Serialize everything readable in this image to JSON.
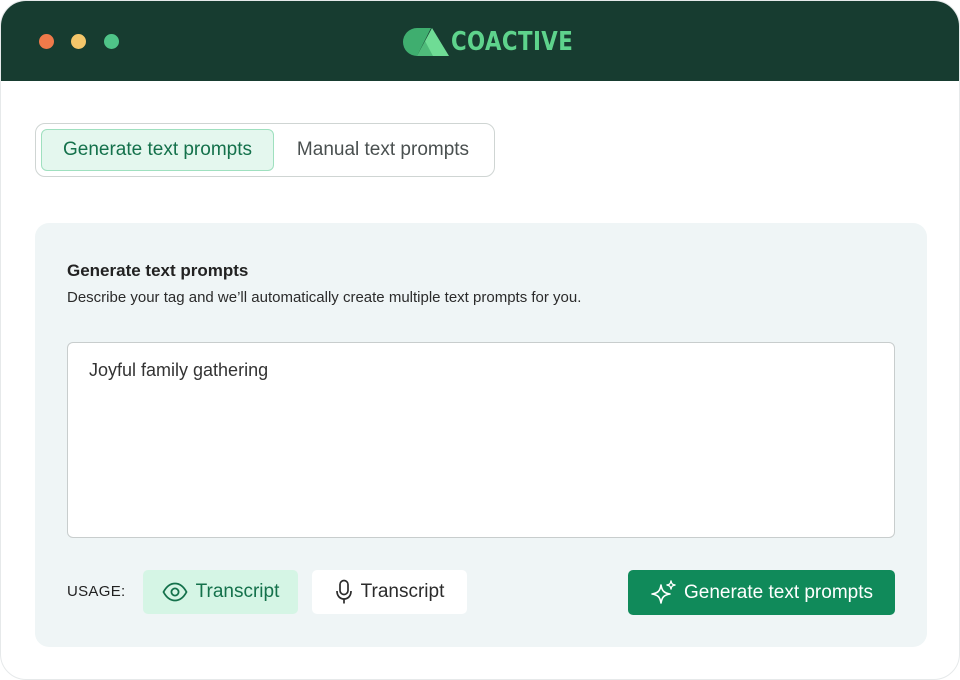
{
  "window": {
    "brand": "COACTIVE",
    "controls": [
      "close",
      "minimize",
      "zoom"
    ],
    "colors": {
      "titlebar": "#173c30",
      "brand": "#5ed38c"
    }
  },
  "tabs": [
    {
      "label": "Generate text prompts",
      "selected": true
    },
    {
      "label": "Manual text prompts",
      "selected": false
    }
  ],
  "panel": {
    "title": "Generate text prompts",
    "description": "Describe your tag and we’ll automatically create multiple text prompts for you.",
    "prompt_value": "Joyful family gathering"
  },
  "usage": {
    "label": "USAGE:",
    "options": [
      {
        "label": "Transcript",
        "icon": "eye-icon",
        "selected": true
      },
      {
        "label": "Transcript",
        "icon": "microphone-icon",
        "selected": false
      }
    ]
  },
  "actions": {
    "generate_label": "Generate text prompts",
    "generate_icon": "sparkles-icon",
    "accent": "#108a5a"
  }
}
